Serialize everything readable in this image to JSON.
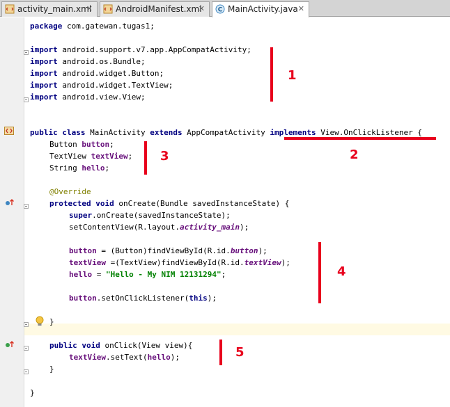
{
  "tabs": [
    {
      "label": "activity_main.xml",
      "icon": "xml-file-icon"
    },
    {
      "label": "AndroidManifest.xml",
      "icon": "xml-file-icon"
    },
    {
      "label": "MainActivity.java",
      "icon": "java-class-icon",
      "active": true
    }
  ],
  "code": {
    "l1": {
      "kw": "package",
      "rest": " com.gatewan.tugas1;"
    },
    "l3": {
      "kw": "import",
      "rest": " android.support.v7.app.AppCompatActivity;"
    },
    "l4": {
      "kw": "import",
      "rest": " android.os.Bundle;"
    },
    "l5": {
      "kw": "import",
      "rest": " android.widget.Button;"
    },
    "l6": {
      "kw": "import",
      "rest": " android.widget.TextView;"
    },
    "l7": {
      "kw": "import",
      "rest": " android.view.View;"
    },
    "l10": {
      "kw1": "public class",
      "a": " MainActivity ",
      "kw2": "extends",
      "b": " AppCompatActivity ",
      "kw3": "implements",
      "c": " View.OnClickListener {"
    },
    "l11": {
      "a": "Button ",
      "f": "button",
      "b": ";"
    },
    "l12": {
      "a": "TextView ",
      "f": "textView",
      "b": ";"
    },
    "l13": {
      "a": "String ",
      "f": "hello",
      "b": ";"
    },
    "l15": {
      "ann": "@Override"
    },
    "l16": {
      "kw": "protected void",
      "rest": " onCreate(Bundle savedInstanceState) {"
    },
    "l17": {
      "kw": "super",
      "rest": ".onCreate(savedInstanceState);"
    },
    "l18": {
      "a": "setContentView(R.layout.",
      "f": "activity_main",
      "b": ");"
    },
    "l20": {
      "f": "button",
      "a": " = (Button)findViewById(R.id.",
      "f2": "button",
      "b": ");"
    },
    "l21": {
      "f": "textView",
      "a": " =(TextView)findViewById(R.id.",
      "f2": "textView",
      "b": ");"
    },
    "l22": {
      "f": "hello",
      "a": " = ",
      "s": "\"Hello - My NIM 12131294\"",
      "b": ";"
    },
    "l24": {
      "f": "button",
      "a": ".setOnClickListener(",
      "kw": "this",
      "b": ");"
    },
    "l26": {
      "a": "}"
    },
    "l28": {
      "kw": "public void",
      "rest": " onClick(View view){"
    },
    "l29": {
      "f": "textView",
      "a": ".setText(",
      "f2": "hello",
      "b": ");"
    },
    "l30": {
      "a": "}"
    },
    "l32": {
      "a": "}"
    }
  },
  "annotations": [
    "1",
    "2",
    "3",
    "4",
    "5"
  ],
  "colors": {
    "accent": "#e8001c",
    "keyword": "#000080",
    "field": "#660e7a",
    "string": "#008000",
    "annotation": "#808000"
  }
}
